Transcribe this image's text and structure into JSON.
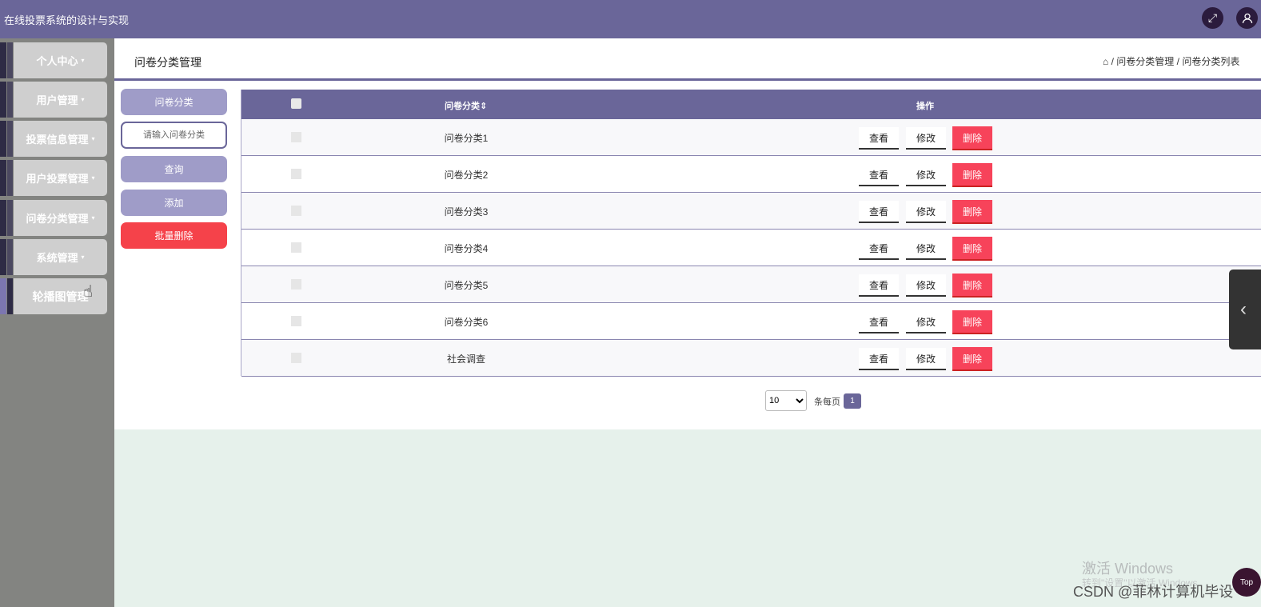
{
  "app": {
    "title": "在线投票系统的设计与实现"
  },
  "header_icons": {
    "fullscreen": "fullscreen-icon",
    "user": "user-icon"
  },
  "sidebar": {
    "items": [
      {
        "label": "个人中心",
        "caret": "▾"
      },
      {
        "label": "用户管理",
        "caret": "▾"
      },
      {
        "label": "投票信息管理",
        "caret": "▾"
      },
      {
        "label": "用户投票管理",
        "caret": "▾"
      },
      {
        "label": "问卷分类管理",
        "caret": "▾"
      },
      {
        "label": "系统管理",
        "caret": "▾"
      },
      {
        "label": "轮播图管理",
        "caret": ""
      }
    ]
  },
  "page": {
    "title": "问卷分类管理",
    "breadcrumb": {
      "home_icon": "⌂",
      "sep": "/",
      "items": [
        "问卷分类管理",
        "问卷分类列表"
      ]
    }
  },
  "filter": {
    "label": "问卷分类",
    "placeholder": "请输入问卷分类",
    "query_label": "查询",
    "add_label": "添加",
    "batch_delete_label": "批量删除"
  },
  "table": {
    "headers": {
      "name": "问卷分类",
      "sort_icon": "⇕",
      "actions": "操作"
    },
    "rows": [
      {
        "name": "问卷分类1"
      },
      {
        "name": "问卷分类2"
      },
      {
        "name": "问卷分类3"
      },
      {
        "name": "问卷分类4"
      },
      {
        "name": "问卷分类5"
      },
      {
        "name": "问卷分类6"
      },
      {
        "name": "社会调查"
      }
    ],
    "actions": {
      "view": "查看",
      "edit": "修改",
      "delete": "删除"
    }
  },
  "pagination": {
    "page_size": "10",
    "per_page_label": "条每页",
    "current_page": "1"
  },
  "overlay": {
    "watermark_line1": "激活 Windows",
    "watermark_line2": "转到\"设置\"以激活 Windows",
    "csdn": "CSDN @菲林计算机毕设",
    "top_label": "Top"
  },
  "colors": {
    "primary": "#6a6699",
    "sidebar_bg": "#838481",
    "danger": "#f5424a",
    "footer_bg": "#e6f1eb"
  }
}
